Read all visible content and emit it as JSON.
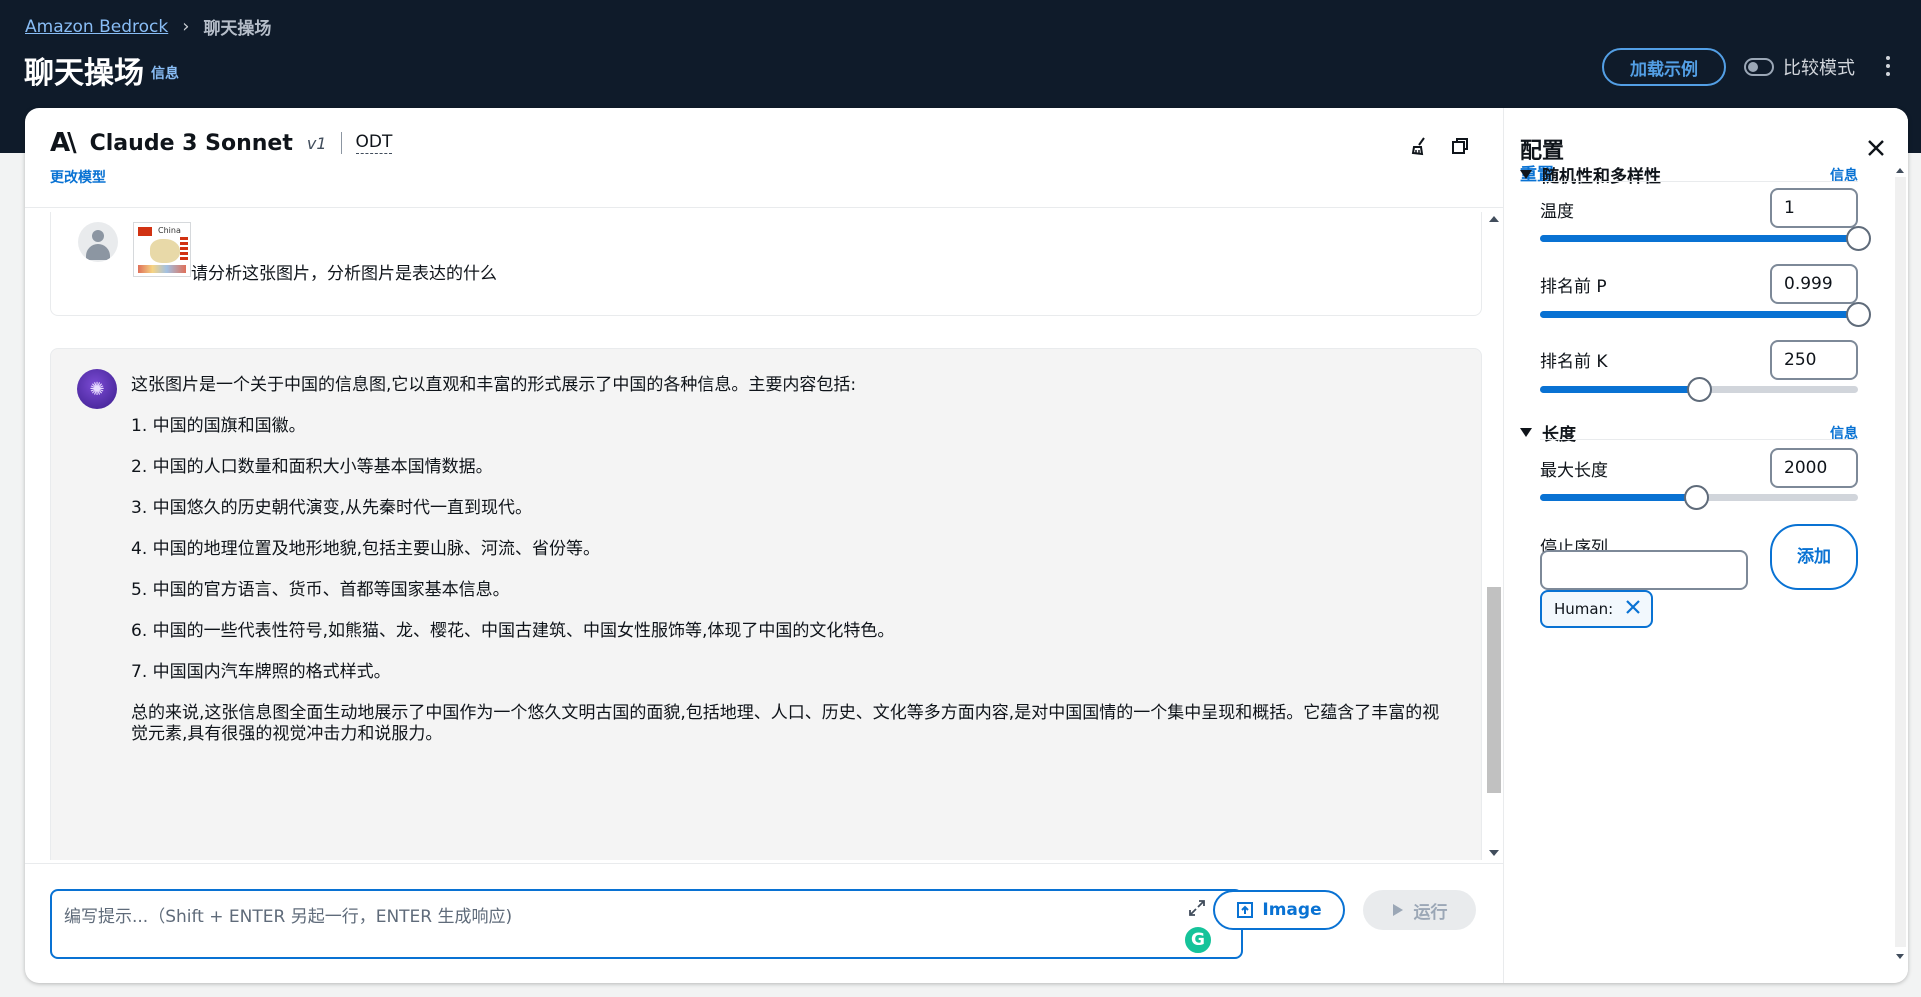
{
  "breadcrumb": {
    "root": "Amazon Bedrock",
    "current": "聊天操场"
  },
  "page": {
    "title": "聊天操场",
    "info": "信息"
  },
  "header": {
    "load_examples": "加载示例",
    "compare_mode": "比较模式"
  },
  "model": {
    "name": "Claude 3 Sonnet",
    "version": "v1",
    "tag": "ODT",
    "change": "更改模型"
  },
  "chat": {
    "user_text": "请分析这张图片，分析图片是表达的什么",
    "bot_paragraphs": [
      "这张图片是一个关于中国的信息图,它以直观和丰富的形式展示了中国的各种信息。主要内容包括:",
      "1. 中国的国旗和国徽。",
      "2. 中国的人口数量和面积大小等基本国情数据。",
      "3. 中国悠久的历史朝代演变,从先秦时代一直到现代。",
      "4. 中国的地理位置及地形地貌,包括主要山脉、河流、省份等。",
      "5. 中国的官方语言、货币、首都等国家基本信息。",
      "6. 中国的一些代表性符号,如熊猫、龙、樱花、中国古建筑、中国女性服饰等,体现了中国的文化特色。",
      "7. 中国国内汽车牌照的格式样式。",
      "总的来说,这张信息图全面生动地展示了中国作为一个悠久文明古国的面貌,包括地理、人口、历史、文化等多方面内容,是对中国国情的一个集中呈现和概括。它蕴含了丰富的视觉元素,具有很强的视觉冲击力和说服力。"
    ]
  },
  "prompt": {
    "placeholder": "编写提示...（Shift + ENTER 另起一行，ENTER 生成响应)",
    "image_button": "Image",
    "run_button": "运行"
  },
  "config": {
    "title": "配置",
    "reset": "重置",
    "sections": [
      {
        "title": "随机性和多样性",
        "info": "信息"
      },
      {
        "title": "长度",
        "info": "信息"
      }
    ],
    "params": {
      "temperature": {
        "label": "温度",
        "value": "1",
        "fraction": 1.0
      },
      "top_p": {
        "label": "排名前 P",
        "value": "0.999",
        "fraction": 0.999
      },
      "top_k": {
        "label": "排名前 K",
        "value": "250",
        "fraction": 0.5
      },
      "max_length": {
        "label": "最大长度",
        "value": "2000",
        "fraction": 0.49
      }
    },
    "stop_sequences": {
      "label": "停止序列",
      "add": "添加",
      "tokens": [
        "Human:"
      ]
    }
  },
  "colors": {
    "accent": "#0972d3",
    "topbar": "#0f1b2a",
    "link_dark": "#539fe5"
  }
}
